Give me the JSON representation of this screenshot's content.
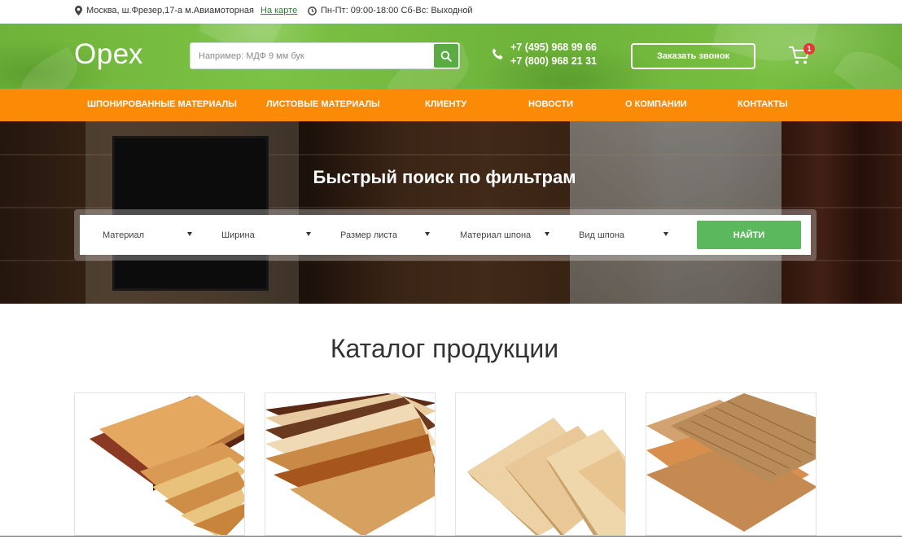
{
  "topbar": {
    "address": "Москва, ш.Фрезер,17-а м.Авиамоторная",
    "map_link": "На карте",
    "hours": "Пн-Пт: 09:00-18:00 Сб-Вс: Выходной"
  },
  "header": {
    "logo": "Орех",
    "search_placeholder": "Например: МДФ 9 мм бук",
    "phones": [
      "+7 (495) 968 99 66",
      "+7 (800) 968 21 31"
    ],
    "callback_label": "Заказать звонок",
    "cart_count": "1"
  },
  "nav": {
    "items": [
      "ШПОНИРОВАННЫЕ МАТЕРИАЛЫ",
      "ЛИСТОВЫЕ МАТЕРИАЛЫ",
      "КЛИЕНТУ",
      "НОВОСТИ",
      "О КОМПАНИИ",
      "КОНТАКТЫ"
    ]
  },
  "hero": {
    "title": "Быстрый поиск по фильтрам",
    "filters": [
      "Материал",
      "Ширина",
      "Размер листа",
      "Материал шпона",
      "Вид шпона"
    ],
    "find_label": "НАЙТИ"
  },
  "catalog": {
    "title": "Каталог продукции"
  },
  "colors": {
    "header_green": "#6fb43a",
    "nav_orange": "#fb8a07",
    "find_green": "#5bb85d",
    "badge_red": "#e53935"
  }
}
